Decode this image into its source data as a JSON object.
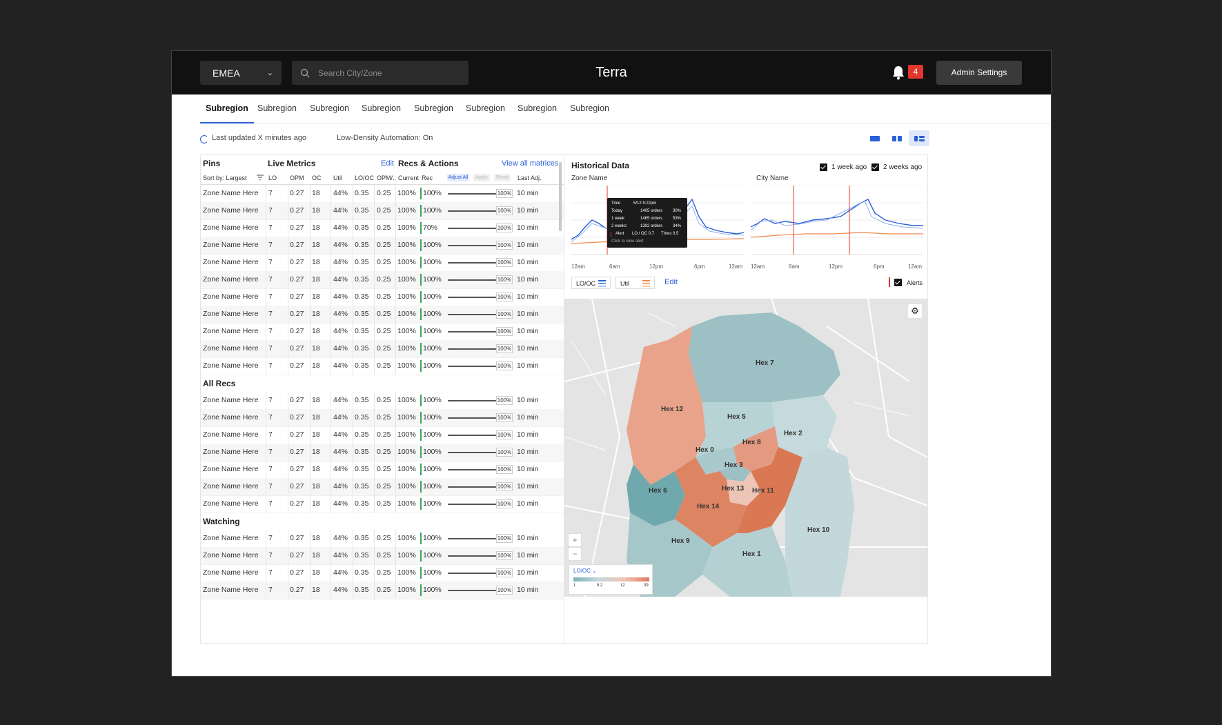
{
  "header": {
    "region": "EMEA",
    "search_placeholder": "Search City/Zone",
    "app_title": "Terra",
    "notification_count": "4",
    "admin_button": "Admin Settings"
  },
  "tabs": [
    "Subregion",
    "Subregion",
    "Subregion",
    "Subregion",
    "Subregion",
    "Subregion",
    "Subregion",
    "Subregion"
  ],
  "status": {
    "last_updated": "Last updated X minutes ago",
    "automation": "Low-Density Automation: On"
  },
  "table": {
    "pins_header": "Pins",
    "live_metrics_header": "Live Metrics",
    "edit_link": "Edit",
    "recs_header": "Recs & Actions",
    "view_all_link": "View all matrices",
    "sort_label": "Sort by: Largest",
    "columns": [
      "LO",
      "OPM",
      "OC",
      "Util",
      "LO/OC",
      "OPM/..",
      "Current",
      "Rec"
    ],
    "adjust_all": "Adjust All",
    "apply": "Apply",
    "reset": "Reset",
    "last_adj": "Last Adj.",
    "sections": [
      {
        "title": "",
        "rows": [
          {
            "zone": "Zone Name Here",
            "lo": "7",
            "opm": "0.27",
            "oc": "18",
            "util": "44%",
            "looc": "0.35",
            "opm2": "0.25",
            "current": "100%",
            "rec": "100%",
            "slider": "100%",
            "last": "10 min"
          },
          {
            "zone": "Zone Name Here",
            "lo": "7",
            "opm": "0.27",
            "oc": "18",
            "util": "44%",
            "looc": "0.35",
            "opm2": "0.25",
            "current": "100%",
            "rec": "100%",
            "slider": "100%",
            "last": "10 min"
          },
          {
            "zone": "Zone Name Here",
            "lo": "7",
            "opm": "0.27",
            "oc": "18",
            "util": "44%",
            "looc": "0.35",
            "opm2": "0.25",
            "current": "100%",
            "rec": "70%",
            "slider": "100%",
            "last": "10 min"
          },
          {
            "zone": "Zone Name Here",
            "lo": "7",
            "opm": "0.27",
            "oc": "18",
            "util": "44%",
            "looc": "0.35",
            "opm2": "0.25",
            "current": "100%",
            "rec": "100%",
            "slider": "100%",
            "last": "10 min"
          },
          {
            "zone": "Zone Name Here",
            "lo": "7",
            "opm": "0.27",
            "oc": "18",
            "util": "44%",
            "looc": "0.35",
            "opm2": "0.25",
            "current": "100%",
            "rec": "100%",
            "slider": "100%",
            "last": "10 min"
          },
          {
            "zone": "Zone Name Here",
            "lo": "7",
            "opm": "0.27",
            "oc": "18",
            "util": "44%",
            "looc": "0.35",
            "opm2": "0.25",
            "current": "100%",
            "rec": "100%",
            "slider": "100%",
            "last": "10 min"
          },
          {
            "zone": "Zone Name Here",
            "lo": "7",
            "opm": "0.27",
            "oc": "18",
            "util": "44%",
            "looc": "0.35",
            "opm2": "0.25",
            "current": "100%",
            "rec": "100%",
            "slider": "100%",
            "last": "10 min"
          },
          {
            "zone": "Zone Name Here",
            "lo": "7",
            "opm": "0.27",
            "oc": "18",
            "util": "44%",
            "looc": "0.35",
            "opm2": "0.25",
            "current": "100%",
            "rec": "100%",
            "slider": "100%",
            "last": "10 min"
          },
          {
            "zone": "Zone Name Here",
            "lo": "7",
            "opm": "0.27",
            "oc": "18",
            "util": "44%",
            "looc": "0.35",
            "opm2": "0.25",
            "current": "100%",
            "rec": "100%",
            "slider": "100%",
            "last": "10 min"
          },
          {
            "zone": "Zone Name Here",
            "lo": "7",
            "opm": "0.27",
            "oc": "18",
            "util": "44%",
            "looc": "0.35",
            "opm2": "0.25",
            "current": "100%",
            "rec": "100%",
            "slider": "100%",
            "last": "10 min"
          },
          {
            "zone": "Zone Name Here",
            "lo": "7",
            "opm": "0.27",
            "oc": "18",
            "util": "44%",
            "looc": "0.35",
            "opm2": "0.25",
            "current": "100%",
            "rec": "100%",
            "slider": "100%",
            "last": "10 min"
          }
        ]
      },
      {
        "title": "All Recs",
        "rows": [
          {
            "zone": "Zone Name Here",
            "lo": "7",
            "opm": "0.27",
            "oc": "18",
            "util": "44%",
            "looc": "0.35",
            "opm2": "0.25",
            "current": "100%",
            "rec": "100%",
            "slider": "100%",
            "last": "10 min"
          },
          {
            "zone": "Zone Name Here",
            "lo": "7",
            "opm": "0.27",
            "oc": "18",
            "util": "44%",
            "looc": "0.35",
            "opm2": "0.25",
            "current": "100%",
            "rec": "100%",
            "slider": "100%",
            "last": "10 min"
          },
          {
            "zone": "Zone Name Here",
            "lo": "7",
            "opm": "0.27",
            "oc": "18",
            "util": "44%",
            "looc": "0.35",
            "opm2": "0.25",
            "current": "100%",
            "rec": "100%",
            "slider": "100%",
            "last": "10 min"
          },
          {
            "zone": "Zone Name Here",
            "lo": "7",
            "opm": "0.27",
            "oc": "18",
            "util": "44%",
            "looc": "0.35",
            "opm2": "0.25",
            "current": "100%",
            "rec": "100%",
            "slider": "100%",
            "last": "10 min"
          },
          {
            "zone": "Zone Name Here",
            "lo": "7",
            "opm": "0.27",
            "oc": "18",
            "util": "44%",
            "looc": "0.35",
            "opm2": "0.25",
            "current": "100%",
            "rec": "100%",
            "slider": "100%",
            "last": "10 min"
          },
          {
            "zone": "Zone Name Here",
            "lo": "7",
            "opm": "0.27",
            "oc": "18",
            "util": "44%",
            "looc": "0.35",
            "opm2": "0.25",
            "current": "100%",
            "rec": "100%",
            "slider": "100%",
            "last": "10 min"
          },
          {
            "zone": "Zone Name Here",
            "lo": "7",
            "opm": "0.27",
            "oc": "18",
            "util": "44%",
            "looc": "0.35",
            "opm2": "0.25",
            "current": "100%",
            "rec": "100%",
            "slider": "100%",
            "last": "10 min"
          }
        ]
      },
      {
        "title": "Watching",
        "rows": [
          {
            "zone": "Zone Name Here",
            "lo": "7",
            "opm": "0.27",
            "oc": "18",
            "util": "44%",
            "looc": "0.35",
            "opm2": "0.25",
            "current": "100%",
            "rec": "100%",
            "slider": "100%",
            "last": "10 min"
          },
          {
            "zone": "Zone Name Here",
            "lo": "7",
            "opm": "0.27",
            "oc": "18",
            "util": "44%",
            "looc": "0.35",
            "opm2": "0.25",
            "current": "100%",
            "rec": "100%",
            "slider": "100%",
            "last": "10 min"
          },
          {
            "zone": "Zone Name Here",
            "lo": "7",
            "opm": "0.27",
            "oc": "18",
            "util": "44%",
            "looc": "0.35",
            "opm2": "0.25",
            "current": "100%",
            "rec": "100%",
            "slider": "100%",
            "last": "10 min"
          },
          {
            "zone": "Zone Name Here",
            "lo": "7",
            "opm": "0.27",
            "oc": "18",
            "util": "44%",
            "looc": "0.35",
            "opm2": "0.25",
            "current": "100%",
            "rec": "100%",
            "slider": "100%",
            "last": "10 min"
          }
        ]
      }
    ]
  },
  "historical": {
    "title": "Historical Data",
    "checkbox_1": "1 week ago",
    "checkbox_2": "2 weeks ago",
    "chart_1_label": "Zone Name",
    "chart_2_label": "City Name",
    "x_ticks": [
      "12am",
      "6am",
      "12pm",
      "6pm",
      "12am"
    ],
    "legend_1": "LO/OC",
    "legend_2": "Util",
    "edit": "Edit",
    "alerts": "Alerts",
    "tooltip": {
      "time_label": "Time",
      "time_value": "5/12  5:22pm",
      "rows": [
        {
          "label": "Today",
          "orders": "1405 orders",
          "pct": "30%"
        },
        {
          "label": "1 week",
          "orders": "1465 orders",
          "pct": "53%"
        },
        {
          "label": "2 weeks",
          "orders": "1392 orders",
          "pct": "34%"
        }
      ],
      "alert_label": "Alert",
      "alert_metric": "LO / OC 0.7",
      "alert_thres": "Thres 0.5",
      "hint": "Click to view alert"
    },
    "colors": {
      "blue": "#2a5fd8",
      "orange": "#f08a4b",
      "alert": "#e0382e"
    }
  },
  "map": {
    "hexes": [
      "Hex 7",
      "Hex 12",
      "Hex 5",
      "Hex 2",
      "Hex 8",
      "Hex 0",
      "Hex 3",
      "Hex 13",
      "Hex 11",
      "Hex 6",
      "Hex 14",
      "Hex 10",
      "Hex 9",
      "Hex 1"
    ],
    "legend_metric": "LO/OC",
    "legend_ticks": [
      "1",
      "8.2",
      "12",
      "39"
    ],
    "zoom_in": "+",
    "zoom_out": "−"
  }
}
